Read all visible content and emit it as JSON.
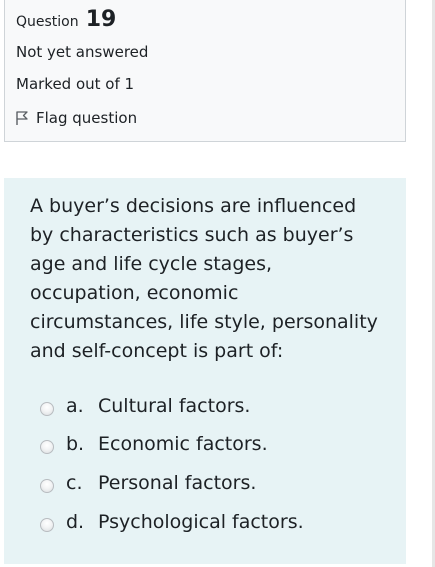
{
  "question_info": {
    "label": "Question",
    "number": "19",
    "state": "Not yet answered",
    "grade": "Marked out of 1",
    "flag_label": "Flag question",
    "flag_icon": "flag-outline-icon"
  },
  "question": {
    "text_lines": [
      "A buyer’s decisions are influenced",
      "by characteristics such as buyer’s",
      "age and life cycle stages,",
      "occupation, economic",
      "circumstances, life style, personality",
      "and self-concept is part of:"
    ],
    "answers": [
      {
        "letter": "a.",
        "text": "Cultural factors.",
        "selected": false
      },
      {
        "letter": "b.",
        "text": "Economic factors.",
        "selected": false
      },
      {
        "letter": "c.",
        "text": "Personal factors.",
        "selected": false
      },
      {
        "letter": "d.",
        "text": "Psychological factors.",
        "selected": false
      }
    ]
  },
  "colors": {
    "info_panel_bg": "#f8f9fa",
    "question_panel_bg": "#e7f3f5",
    "text": "#1d2125",
    "top_box_border": "#d63b3b"
  }
}
